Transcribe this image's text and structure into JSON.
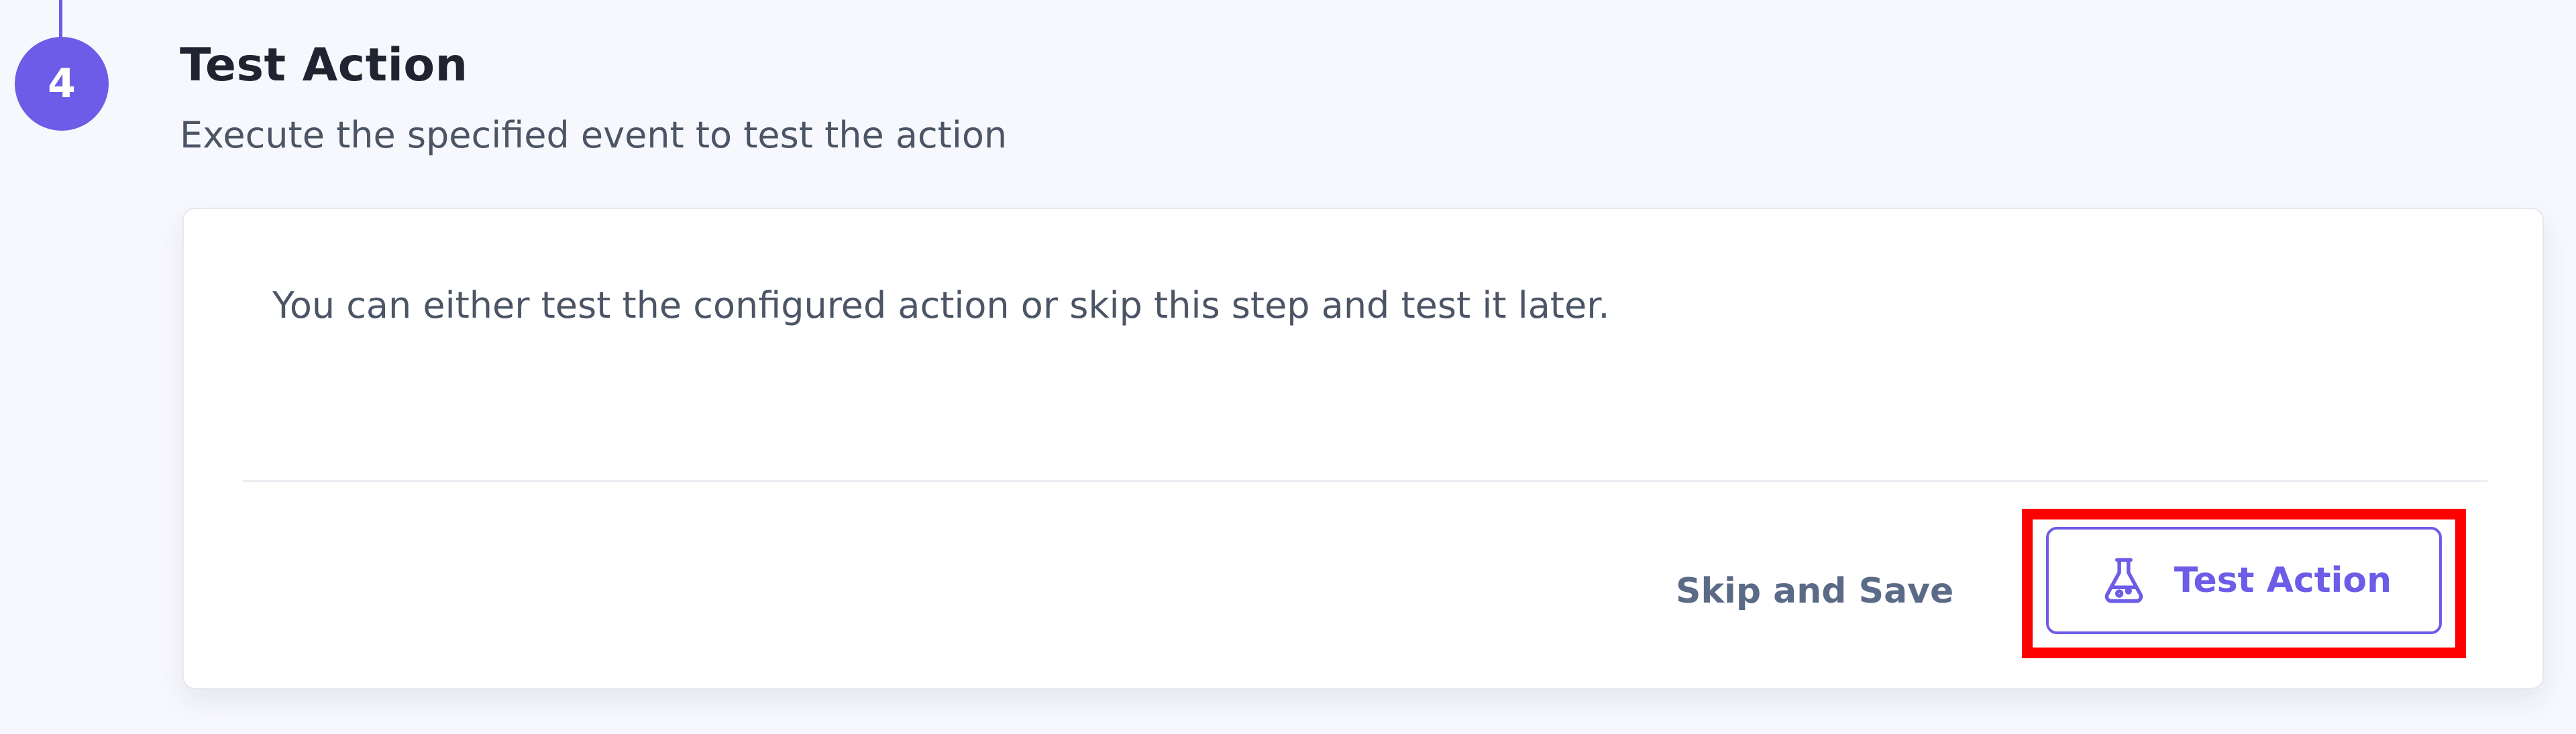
{
  "step": {
    "number": "4",
    "title": "Test Action",
    "subtitle": "Execute the specified event to test the action"
  },
  "card": {
    "message": "You can either test the configured action or skip this step and test it later.",
    "skip_label": "Skip and Save",
    "test_label": "Test Action",
    "test_icon": "flask-icon"
  },
  "colors": {
    "accent": "#6c5ce7",
    "highlight": "#ff0000",
    "text_dark": "#1f2430",
    "text_muted": "#4b5565"
  }
}
